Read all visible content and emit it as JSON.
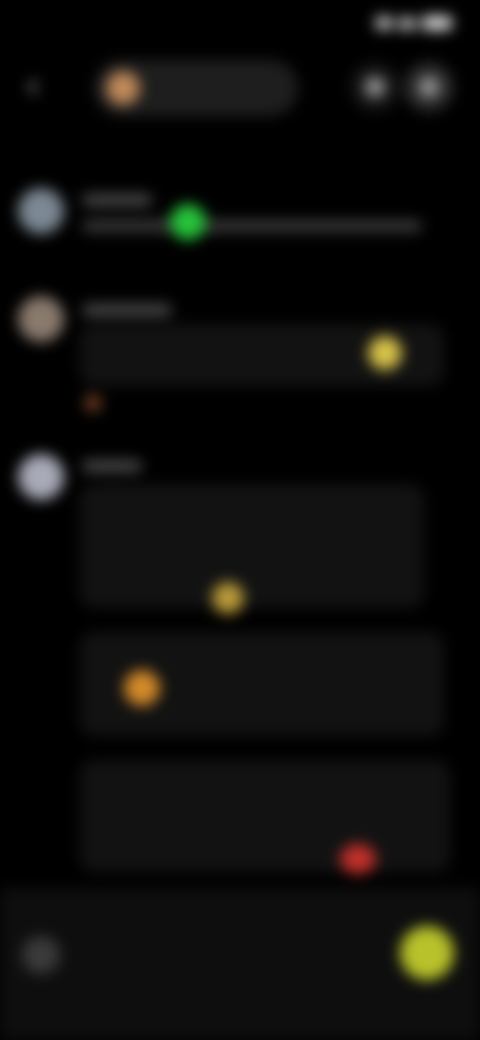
{
  "colors": {
    "background": "#000000",
    "bubble": "#121212",
    "accent_green": "#26c23a",
    "accent_yellow": "#d6c24a",
    "accent_orange": "#d48a2a",
    "accent_red": "#c0302a",
    "send_button": "#b8c22a"
  },
  "icons": {
    "back": "chevron-left-icon",
    "send": "send-icon",
    "attach": "plus-icon"
  },
  "status_bar": {
    "time": ""
  },
  "header": {
    "channel_name": ""
  },
  "messages": [
    {
      "author": "",
      "text": ""
    },
    {
      "author": "",
      "text": ""
    },
    {
      "author": "",
      "text": ""
    }
  ],
  "composer": {
    "placeholder": ""
  }
}
